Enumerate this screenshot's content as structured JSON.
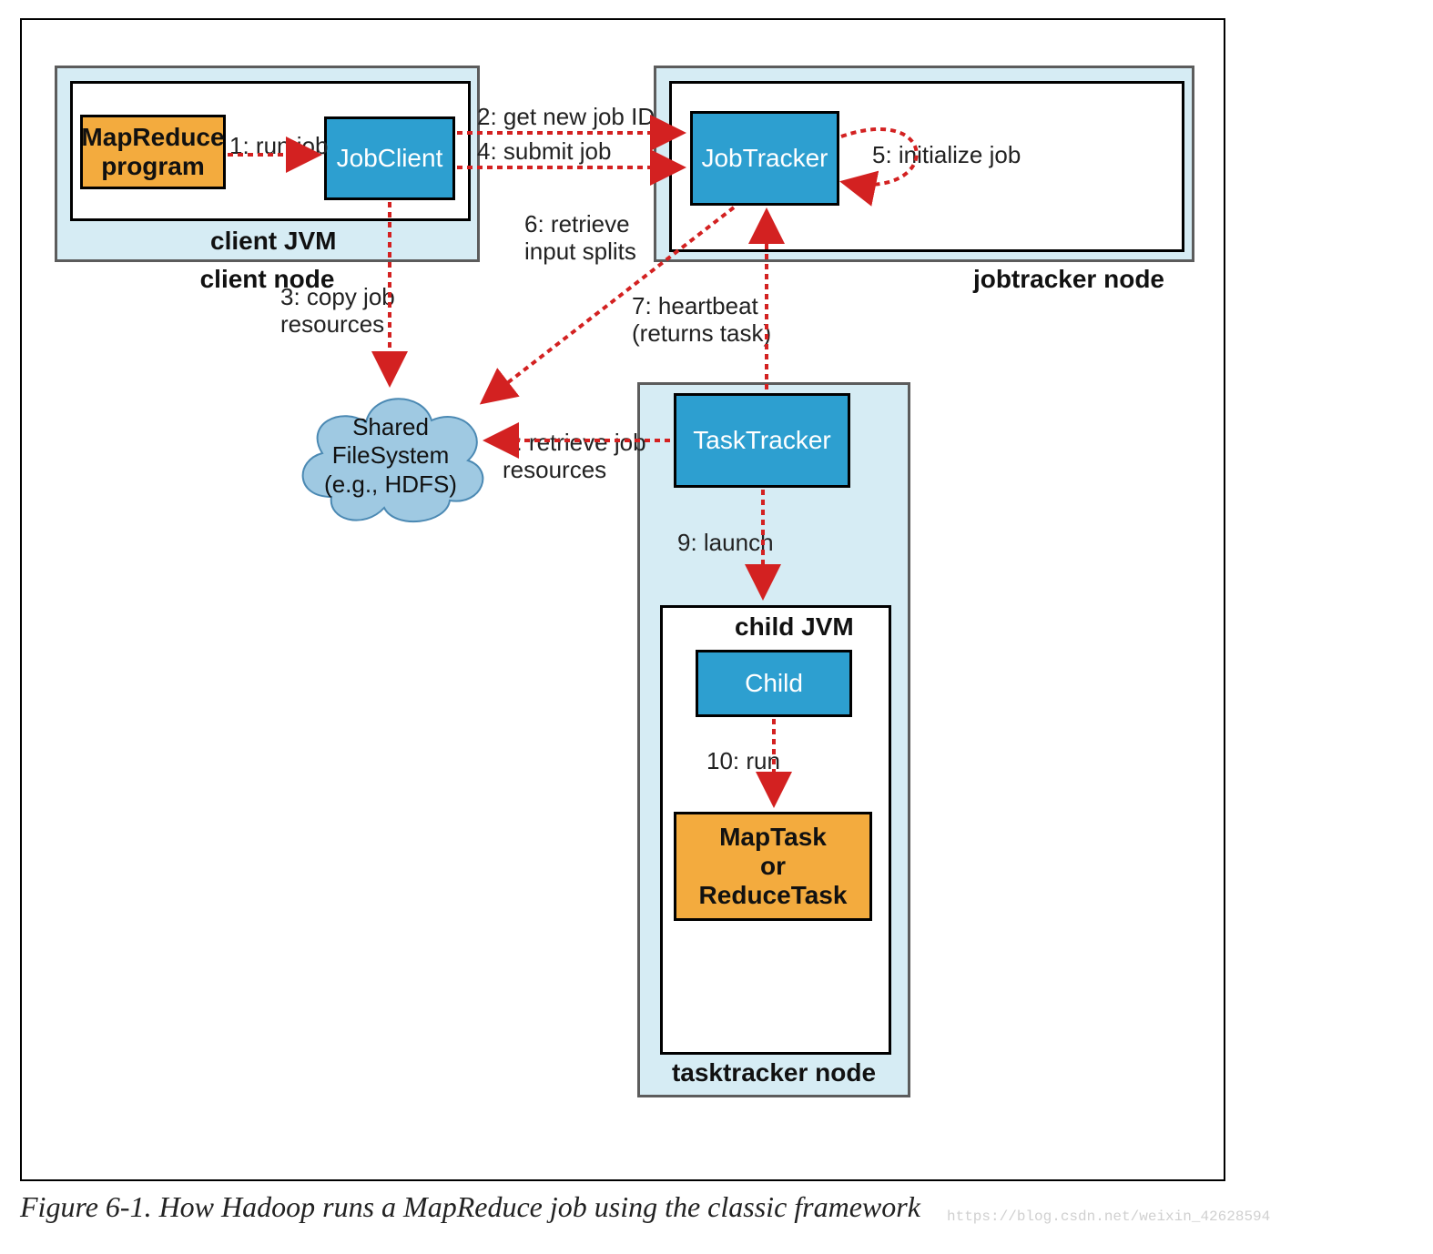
{
  "caption": "Figure 6-1. How Hadoop runs a MapReduce job using the classic framework",
  "watermark": "https://blog.csdn.net/weixin_42628594",
  "nodes": {
    "client_node": {
      "label": "client node",
      "jvm_label": "client JVM"
    },
    "jobtracker_node": {
      "label": "jobtracker node"
    },
    "tasktracker_node": {
      "label": "tasktracker node",
      "jvm_label": "child JVM"
    }
  },
  "components": {
    "mapreduce_program": "MapReduce\nprogram",
    "jobclient": "JobClient",
    "jobtracker": "JobTracker",
    "tasktracker": "TaskTracker",
    "child": "Child",
    "maptask": "MapTask\nor\nReduceTask",
    "shared_fs": "Shared\nFileSystem\n(e.g., HDFS)"
  },
  "edges": {
    "e1": "1: run job",
    "e2": "2: get new job ID",
    "e3": "3: copy job\nresources",
    "e4": "4: submit job",
    "e5": "5: initialize job",
    "e6": "6: retrieve\ninput splits",
    "e7": "7: heartbeat\n(returns task)",
    "e8": "8: retrieve job\nresources",
    "e9": "9: launch",
    "e10": "10: run"
  }
}
